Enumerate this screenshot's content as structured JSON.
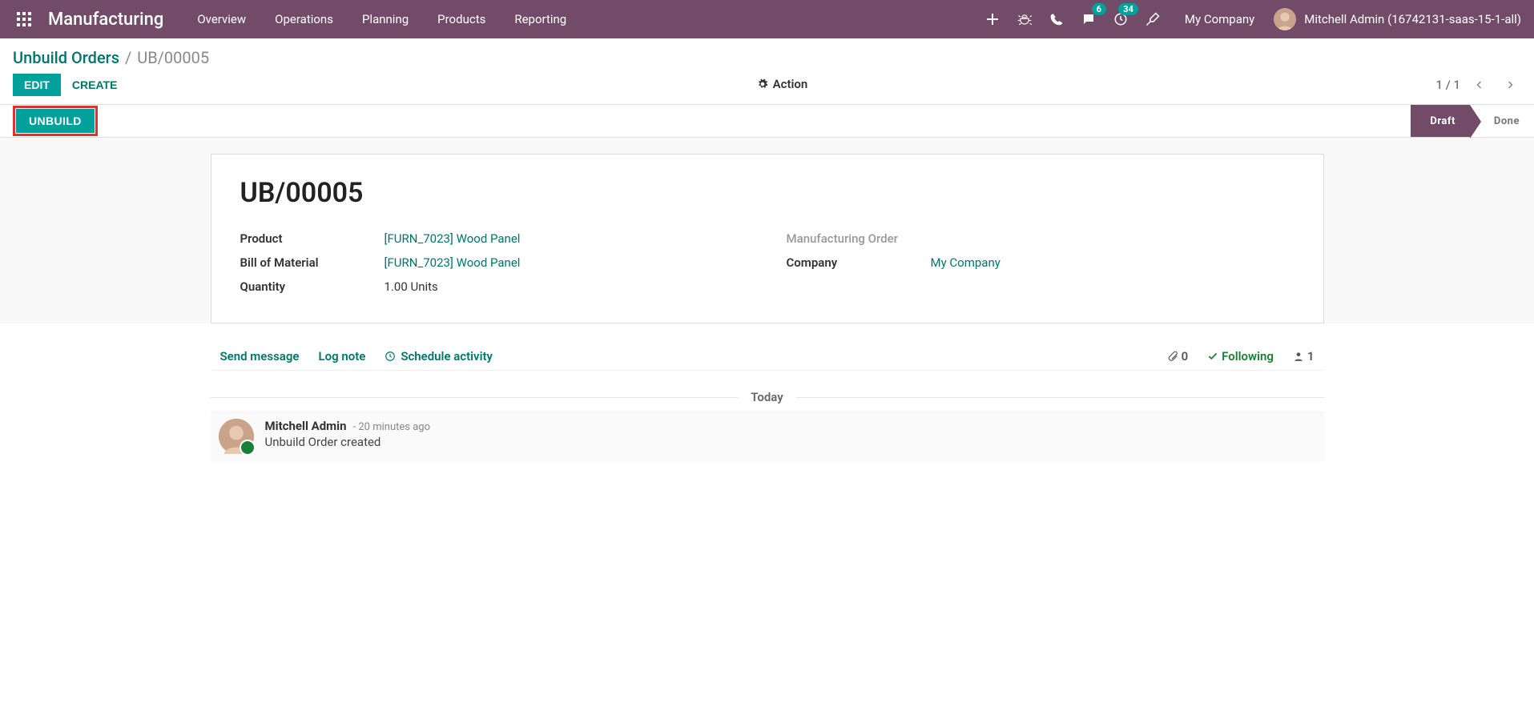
{
  "navbar": {
    "brand": "Manufacturing",
    "menu": [
      "Overview",
      "Operations",
      "Planning",
      "Products",
      "Reporting"
    ],
    "messages_badge": "6",
    "activities_badge": "34",
    "company": "My Company",
    "user": "Mitchell Admin (16742131-saas-15-1-all)"
  },
  "breadcrumb": {
    "parent": "Unbuild Orders",
    "current": "UB/00005"
  },
  "buttons": {
    "edit": "Edit",
    "create": "Create",
    "action": "Action",
    "unbuild": "Unbuild"
  },
  "pager": {
    "text": "1 / 1"
  },
  "status": {
    "draft": "Draft",
    "done": "Done"
  },
  "record": {
    "name": "UB/00005",
    "labels": {
      "product": "Product",
      "bom": "Bill of Material",
      "quantity": "Quantity",
      "mo": "Manufacturing Order",
      "company": "Company"
    },
    "product": "[FURN_7023] Wood Panel",
    "bom": "[FURN_7023] Wood Panel",
    "quantity_value": "1.00",
    "quantity_uom": "Units",
    "company": "My Company"
  },
  "chatter": {
    "send_message": "Send message",
    "log_note": "Log note",
    "schedule_activity": "Schedule activity",
    "attachments_count": "0",
    "following": "Following",
    "followers_count": "1",
    "day": "Today",
    "message": {
      "author": "Mitchell Admin",
      "time": "- 20 minutes ago",
      "body": "Unbuild Order created"
    }
  }
}
